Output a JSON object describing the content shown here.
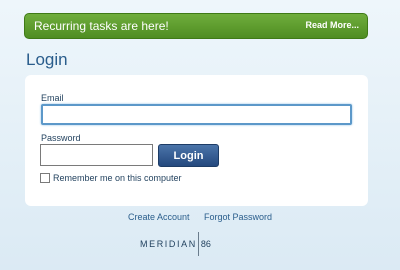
{
  "banner": {
    "message": "Recurring tasks are here!",
    "link_label": "Read More..."
  },
  "page": {
    "title": "Login"
  },
  "form": {
    "email_label": "Email",
    "email_value": "",
    "password_label": "Password",
    "password_value": "",
    "login_button": "Login",
    "remember_label": "Remember me on this computer",
    "remember_checked": false
  },
  "footer": {
    "create_account": "Create Account",
    "forgot_password": "Forgot Password"
  },
  "logo": {
    "name": "MERIDIAN",
    "number": "86"
  },
  "colors": {
    "banner_green": "#5a9a2d",
    "title_blue": "#2a5d8c",
    "button_blue": "#2f5b93",
    "focus_border": "#5c98c9"
  }
}
